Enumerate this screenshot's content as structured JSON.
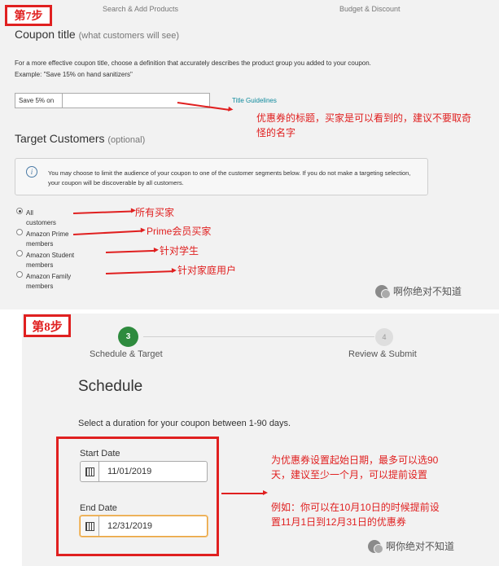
{
  "step7": {
    "label": "第7步",
    "progress": {
      "left": "Search & Add Products",
      "right": "Budget & Discount"
    },
    "coupon_title": {
      "heading": "Coupon title",
      "heading_note": "(what customers will see)",
      "description": "For a more effective coupon title, choose a definition that accurately describes the product group you added to your coupon.",
      "example": "Example: \"Save 15% on hand sanitizers\"",
      "prefix": "Save 5% on",
      "value": "",
      "guidelines_link": "Title Guidelines",
      "annotation_line1": "优惠券的标题，买家是可以看到的，建议不要取奇",
      "annotation_line2": "怪的名字"
    },
    "target": {
      "heading": "Target Customers",
      "heading_note": "(optional)",
      "info": "You may choose to limit the audience of your coupon to one of the customer segments below. If you do not make a targeting selection, your coupon will be discoverable by all customers.",
      "options": [
        {
          "line1": "All",
          "line2": "customers",
          "selected": true,
          "note": "所有买家"
        },
        {
          "line1": "Amazon Prime",
          "line2": "members",
          "selected": false,
          "note": "Prime会员买家"
        },
        {
          "line1": "Amazon Student",
          "line2": "members",
          "selected": false,
          "note": "针对学生"
        },
        {
          "line1": "Amazon Family",
          "line2": "members",
          "selected": false,
          "note": "针对家庭用户"
        }
      ]
    },
    "watermark": "啊你绝对不知道"
  },
  "step8": {
    "label": "第8步",
    "steps": [
      {
        "number": "3",
        "label": "Schedule & Target",
        "active": true
      },
      {
        "number": "4",
        "label": "Review & Submit",
        "active": false
      }
    ],
    "heading": "Schedule",
    "description": "Select a duration for your coupon between 1-90 days.",
    "start_label": "Start Date",
    "start_value": "11/01/2019",
    "end_label": "End Date",
    "end_value": "12/31/2019",
    "annotation_line1": "为优惠券设置起始日期，最多可以选90",
    "annotation_line2": "天，建议至少一个月，可以提前设置",
    "annotation_line3": "例如：你可以在10月10日的时候提前设",
    "annotation_line4": "置11月1日到12月31日的优惠券",
    "watermark": "啊你绝对不知道"
  },
  "colors": {
    "accent_red": "#e02020",
    "step_green": "#2e8b3e",
    "link_teal": "#0f8a9d",
    "end_date_focus": "#e8a33d"
  }
}
